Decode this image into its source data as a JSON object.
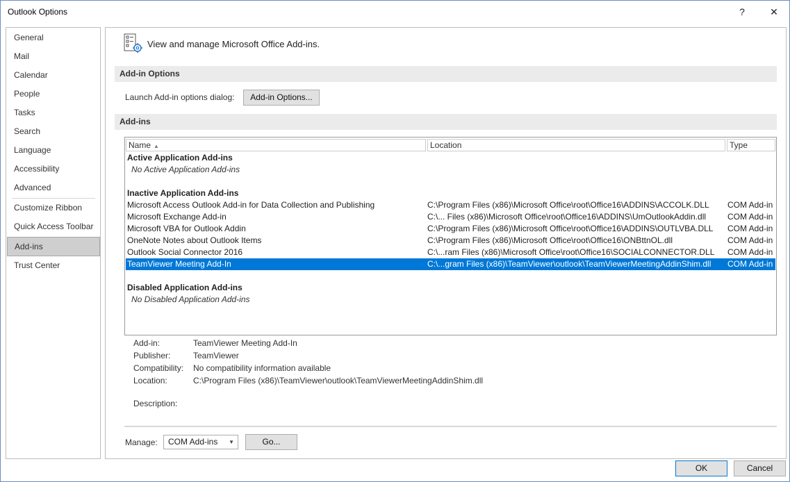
{
  "window": {
    "title": "Outlook Options",
    "help_glyph": "?",
    "close_glyph": "✕"
  },
  "sidebar": {
    "items": [
      {
        "label": "General"
      },
      {
        "label": "Mail"
      },
      {
        "label": "Calendar"
      },
      {
        "label": "People"
      },
      {
        "label": "Tasks"
      },
      {
        "label": "Search"
      },
      {
        "label": "Language"
      },
      {
        "label": "Accessibility"
      },
      {
        "label": "Advanced"
      },
      {
        "label": "Customize Ribbon"
      },
      {
        "label": "Quick Access Toolbar"
      },
      {
        "label": "Add-ins"
      },
      {
        "label": "Trust Center"
      }
    ],
    "active": "Add-ins"
  },
  "main": {
    "header": "View and manage Microsoft Office Add-ins.",
    "addin_options_section": "Add-in Options",
    "launch_label": "Launch Add-in options dialog:",
    "addin_options_button": "Add-in Options...",
    "addins_section": "Add-ins",
    "table": {
      "columns": {
        "name": "Name",
        "location": "Location",
        "type": "Type"
      },
      "groups": {
        "active_title": "Active Application Add-ins",
        "active_empty": "No Active Application Add-ins",
        "inactive_title": "Inactive Application Add-ins",
        "disabled_title": "Disabled Application Add-ins",
        "disabled_empty": "No Disabled Application Add-ins"
      },
      "inactive_rows": [
        {
          "name": "Microsoft Access Outlook Add-in for Data Collection and Publishing",
          "location": "C:\\Program Files (x86)\\Microsoft Office\\root\\Office16\\ADDINS\\ACCOLK.DLL",
          "type": "COM Add-in"
        },
        {
          "name": "Microsoft Exchange Add-in",
          "location": "C:\\... Files (x86)\\Microsoft Office\\root\\Office16\\ADDINS\\UmOutlookAddin.dll",
          "type": "COM Add-in"
        },
        {
          "name": "Microsoft VBA for Outlook Addin",
          "location": "C:\\Program Files (x86)\\Microsoft Office\\root\\Office16\\ADDINS\\OUTLVBA.DLL",
          "type": "COM Add-in"
        },
        {
          "name": "OneNote Notes about Outlook Items",
          "location": "C:\\Program Files (x86)\\Microsoft Office\\root\\Office16\\ONBttnOL.dll",
          "type": "COM Add-in"
        },
        {
          "name": "Outlook Social Connector 2016",
          "location": "C:\\...ram Files (x86)\\Microsoft Office\\root\\Office16\\SOCIALCONNECTOR.DLL",
          "type": "COM Add-in"
        },
        {
          "name": "TeamViewer Meeting Add-In",
          "location": "C:\\...gram Files (x86)\\TeamViewer\\outlook\\TeamViewerMeetingAddinShim.dll",
          "type": "COM Add-in"
        }
      ],
      "selected_index": 5
    },
    "details": {
      "addin_label": "Add-in:",
      "addin_value": "TeamViewer Meeting Add-In",
      "publisher_label": "Publisher:",
      "publisher_value": "TeamViewer",
      "compat_label": "Compatibility:",
      "compat_value": "No compatibility information available",
      "location_label": "Location:",
      "location_value": "C:\\Program Files (x86)\\TeamViewer\\outlook\\TeamViewerMeetingAddinShim.dll",
      "description_label": "Description:"
    },
    "manage": {
      "label": "Manage:",
      "selected": "COM Add-ins",
      "go_button": "Go..."
    }
  },
  "footer": {
    "ok": "OK",
    "cancel": "Cancel"
  },
  "colors": {
    "selection": "#0078d7",
    "section_bar": "#ebebeb",
    "active_nav": "#cfcfcf"
  }
}
